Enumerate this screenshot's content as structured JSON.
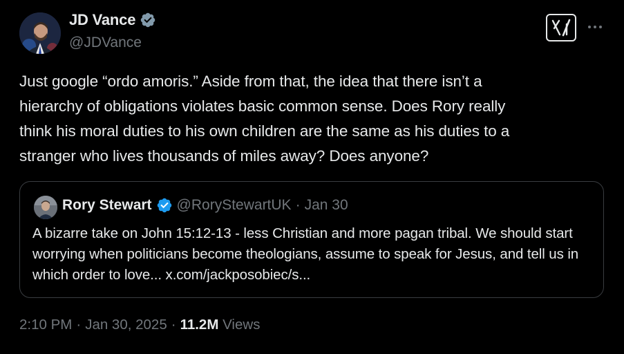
{
  "author": {
    "display_name": "JD Vance",
    "handle": "@JDVance",
    "verified_color": "#829aab"
  },
  "tweet": {
    "text": "Just google “ordo amoris.” Aside from that, the idea that there isn’t a\nhierarchy of obligations violates basic common sense. Does Rory really\nthink his moral duties to his own children are the same as his duties to a\nstranger who lives thousands of miles away? Does anyone?"
  },
  "quoted_tweet": {
    "display_name": "Rory Stewart",
    "handle": "@RoryStewartUK",
    "separator": "·",
    "date": "Jan 30",
    "verified_color": "#1d9bf0",
    "text": "A bizarre take on John 15:12-13  - less Christian and more pagan tribal. We should start worrying when politicians become theologians, assume to speak for Jesus, and tell us in which order to love... x.com/jackposobiec/s..."
  },
  "meta": {
    "time": "2:10 PM",
    "separator": "·",
    "date": "Jan 30, 2025",
    "separator2": "·",
    "views_count": "11.2M",
    "views_label": "Views"
  },
  "icons": {
    "grok": "grok-icon",
    "more": "more-icon",
    "verified": "verified-badge-icon"
  },
  "colors": {
    "background": "#000000",
    "text_primary": "#e7e9ea",
    "text_secondary": "#71767b",
    "border": "#3a3d41"
  }
}
